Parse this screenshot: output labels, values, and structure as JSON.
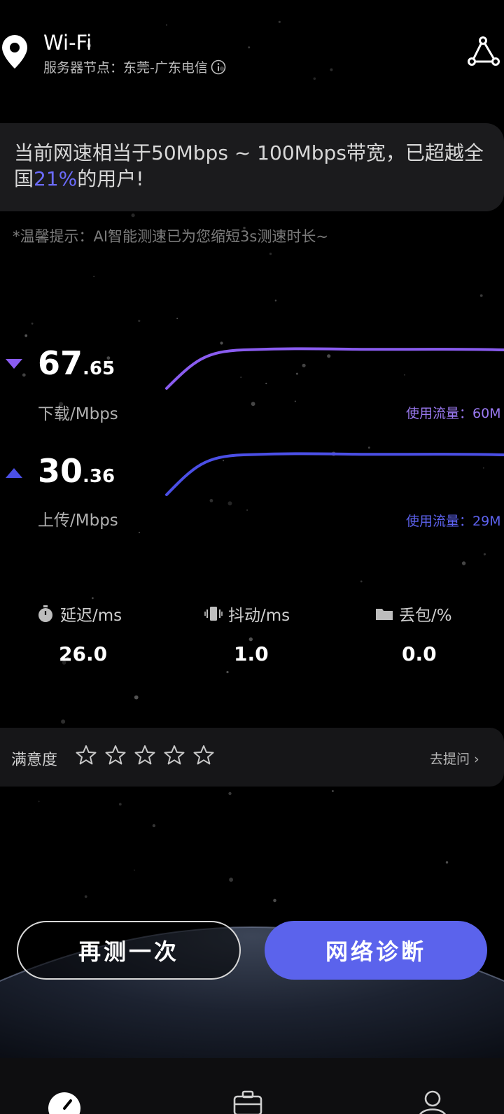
{
  "header": {
    "title": "Wi-Fi",
    "server": "服务器节点：东莞-广东电信",
    "icons": [
      "location-pin-icon",
      "info-icon",
      "route-share-icon"
    ]
  },
  "banner": {
    "text_before": "当前网速相当于50Mbps ~ 100Mbps带宽，已超越全国",
    "percentile": "21%",
    "text_after": "的用户!",
    "highlight_color": "#6c6cff"
  },
  "tip": "*温馨提示：AI智能测速已为您缩短3s测速时长~",
  "download": {
    "int": "67",
    "dec": ".65",
    "unit": "下载/Mbps",
    "usage": "使用流量：60M",
    "color": "#8a5cf0",
    "curve": [
      0.9,
      1.0,
      1.0,
      1.0
    ]
  },
  "upload": {
    "int": "30",
    "dec": ".36",
    "unit": "上传/Mbps",
    "usage": "使用流量：29M",
    "color": "#4b4fe6",
    "curve": [
      0.88,
      1.0,
      1.0,
      1.0
    ]
  },
  "metrics": [
    {
      "label": "延迟/ms",
      "value": "26.0",
      "icon": "stopwatch-icon"
    },
    {
      "label": "抖动/ms",
      "value": "1.0",
      "icon": "vibration-icon"
    },
    {
      "label": "丢包/%",
      "value": "0.0",
      "icon": "folder-icon"
    }
  ],
  "satisfaction": {
    "label": "满意度",
    "rating": 0,
    "max": 5,
    "link": "去提问 ›"
  },
  "buttons": {
    "retest": "再测一次",
    "diagnose": "网络诊断",
    "accent": "#5b63ec"
  },
  "nav": {
    "items": [
      "speedometer-icon",
      "toolbox-icon",
      "user-icon"
    ]
  }
}
